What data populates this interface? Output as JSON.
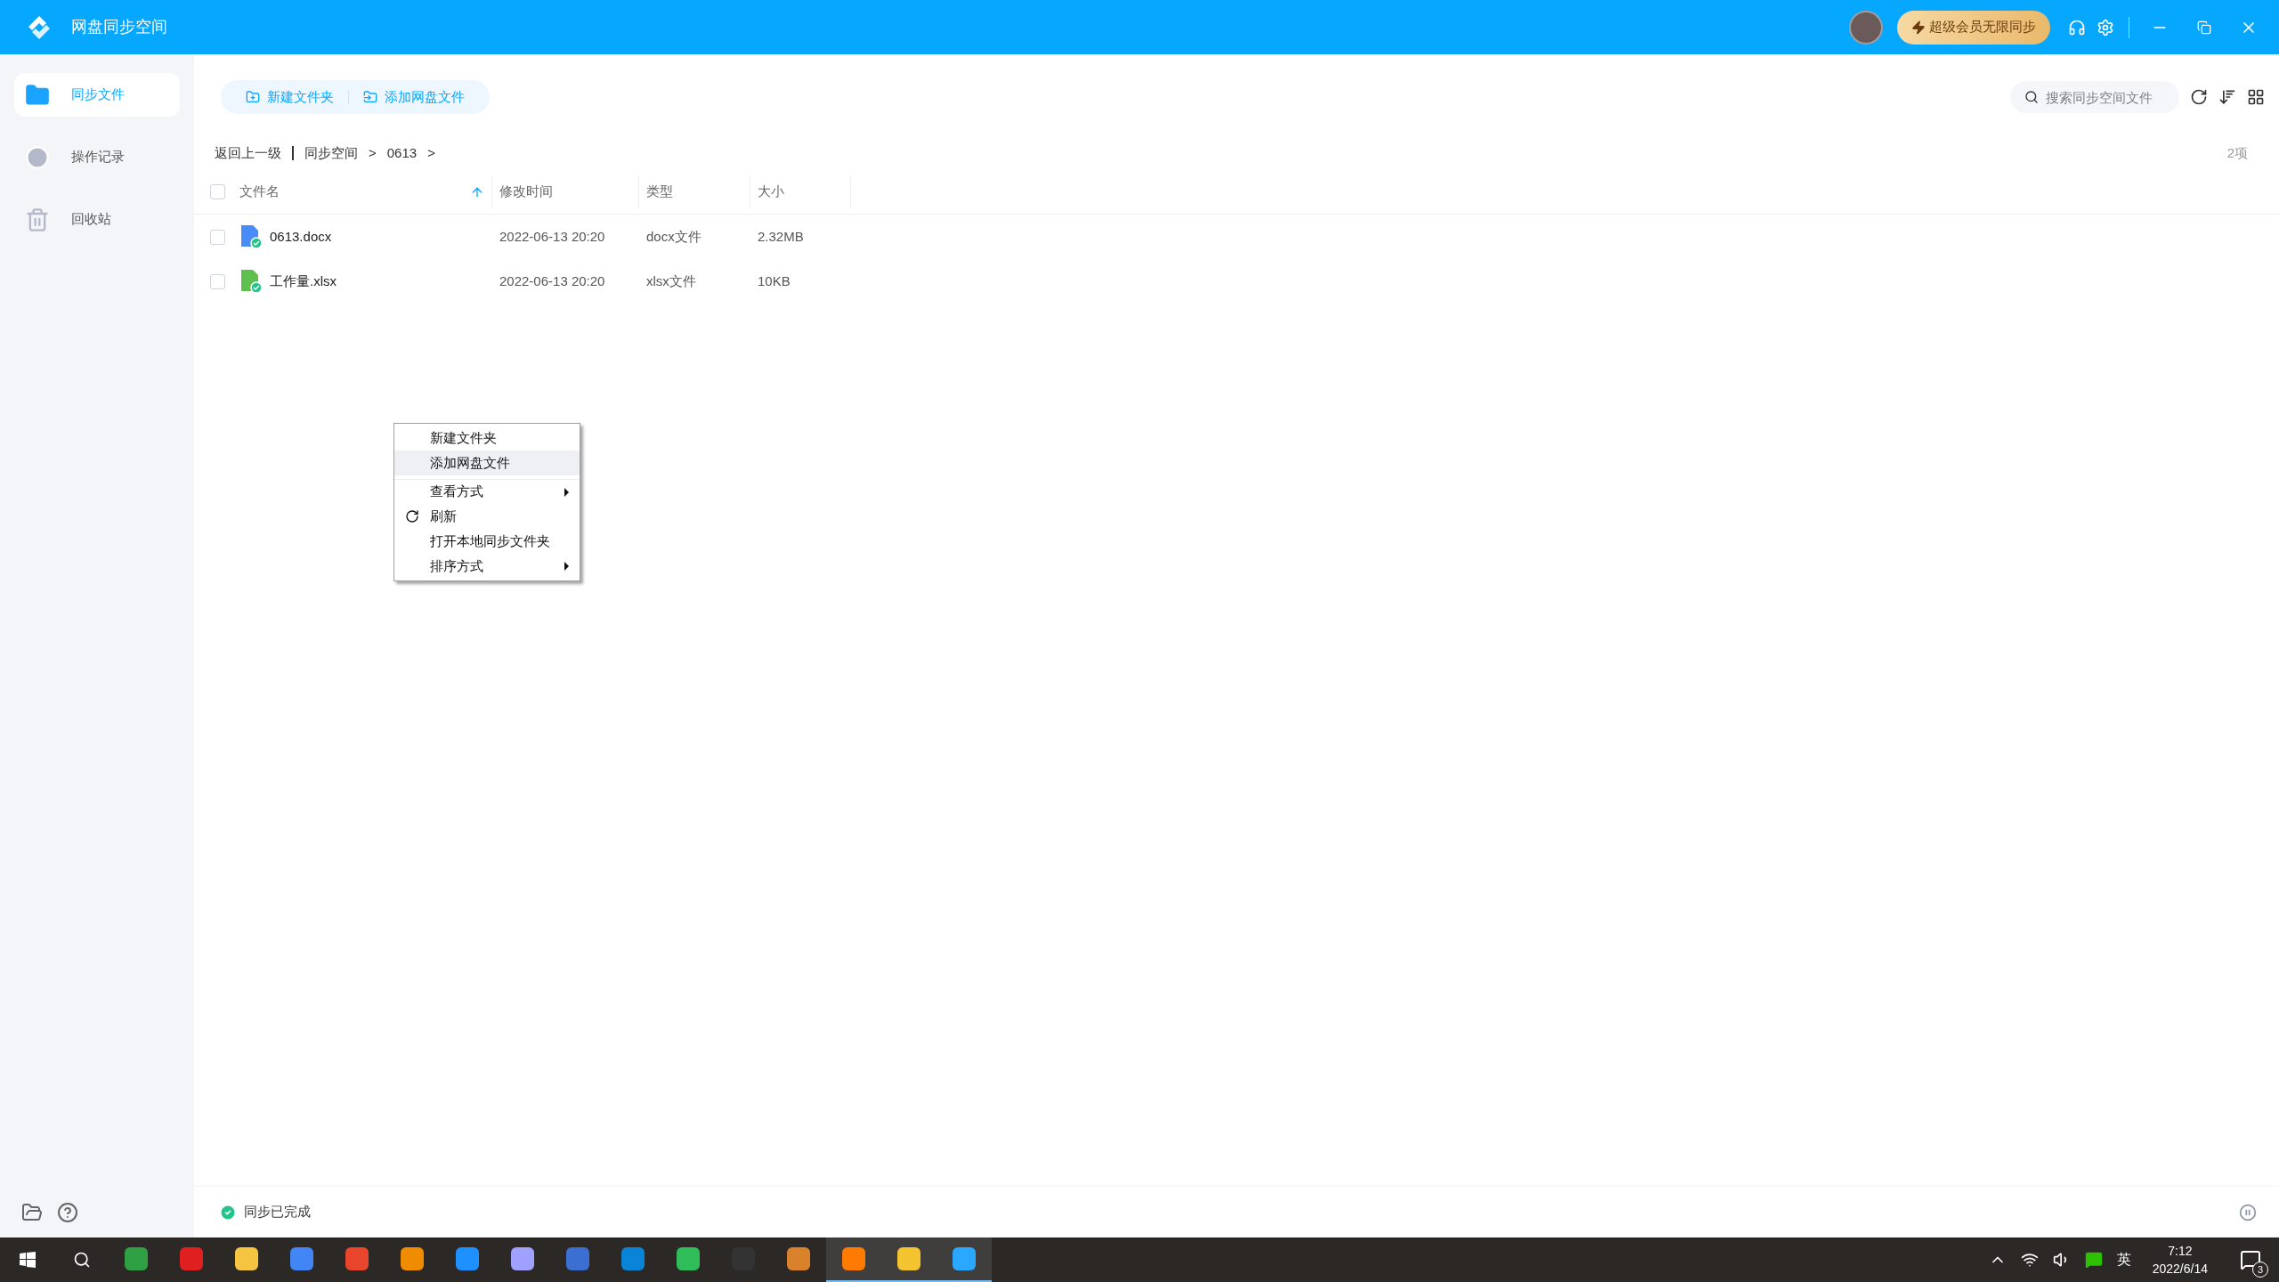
{
  "window": {
    "title": "网盘同步空间",
    "vip_button": "超级会员无限同步"
  },
  "sidebar": {
    "items": [
      {
        "kind": "sync",
        "label": "同步文件",
        "selected": true
      },
      {
        "kind": "history",
        "label": "操作记录",
        "selected": false
      },
      {
        "kind": "trash",
        "label": "回收站",
        "selected": false
      }
    ]
  },
  "toolbar": {
    "buttons": [
      {
        "kind": "new",
        "label": "新建文件夹"
      },
      {
        "kind": "add",
        "label": "添加网盘文件"
      }
    ],
    "search": {
      "placeholder": "搜索同步空间文件"
    }
  },
  "breadcrumb": {
    "back": "返回上一级",
    "path": [
      "同步空间",
      "0613"
    ],
    "separator": ">",
    "count": "2项"
  },
  "table": {
    "select_all_checked": false,
    "columns": [
      {
        "label": "文件名",
        "sorted": true
      },
      {
        "label": "修改时间",
        "sorted": false
      },
      {
        "label": "类型",
        "sorted": false
      },
      {
        "label": "大小",
        "sorted": false
      }
    ],
    "rows": [
      {
        "kind": "docx",
        "checked": false,
        "name": "0613.docx",
        "modified": "2022-06-13 20:20",
        "type": "docx文件",
        "size": "2.32MB"
      },
      {
        "kind": "xlsx",
        "checked": false,
        "name": "工作量.xlsx",
        "modified": "2022-06-13 20:20",
        "type": "xlsx文件",
        "size": "10KB"
      }
    ]
  },
  "context_menu": {
    "items": [
      {
        "label": "新建文件夹",
        "highlighted": false,
        "submenu": false,
        "icon": false
      },
      {
        "label": "添加网盘文件",
        "highlighted": true,
        "submenu": false,
        "icon": false
      },
      {
        "label": "查看方式",
        "highlighted": false,
        "submenu": true,
        "icon": false
      },
      {
        "label": "刷新",
        "highlighted": false,
        "submenu": false,
        "icon": true
      },
      {
        "label": "打开本地同步文件夹",
        "highlighted": false,
        "submenu": false,
        "icon": false
      },
      {
        "label": "排序方式",
        "highlighted": false,
        "submenu": true,
        "icon": false
      }
    ]
  },
  "status_bar": {
    "text": "同步已完成"
  },
  "taskbar": {
    "apps": [
      {
        "color": "#2ea043",
        "running": false
      },
      {
        "color": "#e02020",
        "running": false
      },
      {
        "color": "#f5c542",
        "running": false
      },
      {
        "color": "#4285f4",
        "running": false
      },
      {
        "color": "#e8452c",
        "running": false
      },
      {
        "color": "#f08c00",
        "running": false
      },
      {
        "color": "#1e90ff",
        "running": false
      },
      {
        "color": "#a0a0ff",
        "running": false
      },
      {
        "color": "#3b6fd1",
        "running": false
      },
      {
        "color": "#0a84d6",
        "running": false
      },
      {
        "color": "#2ebd59",
        "running": false
      },
      {
        "color": "#333333",
        "running": false
      },
      {
        "color": "#d9822b",
        "running": false
      },
      {
        "color": "#ff7a00",
        "running": true
      },
      {
        "color": "#f4c430",
        "running": true
      },
      {
        "color": "#2aa8ff",
        "running": true
      }
    ],
    "ime": "英",
    "time": "7:12",
    "date": "2022/6/14",
    "notifications": "3"
  }
}
